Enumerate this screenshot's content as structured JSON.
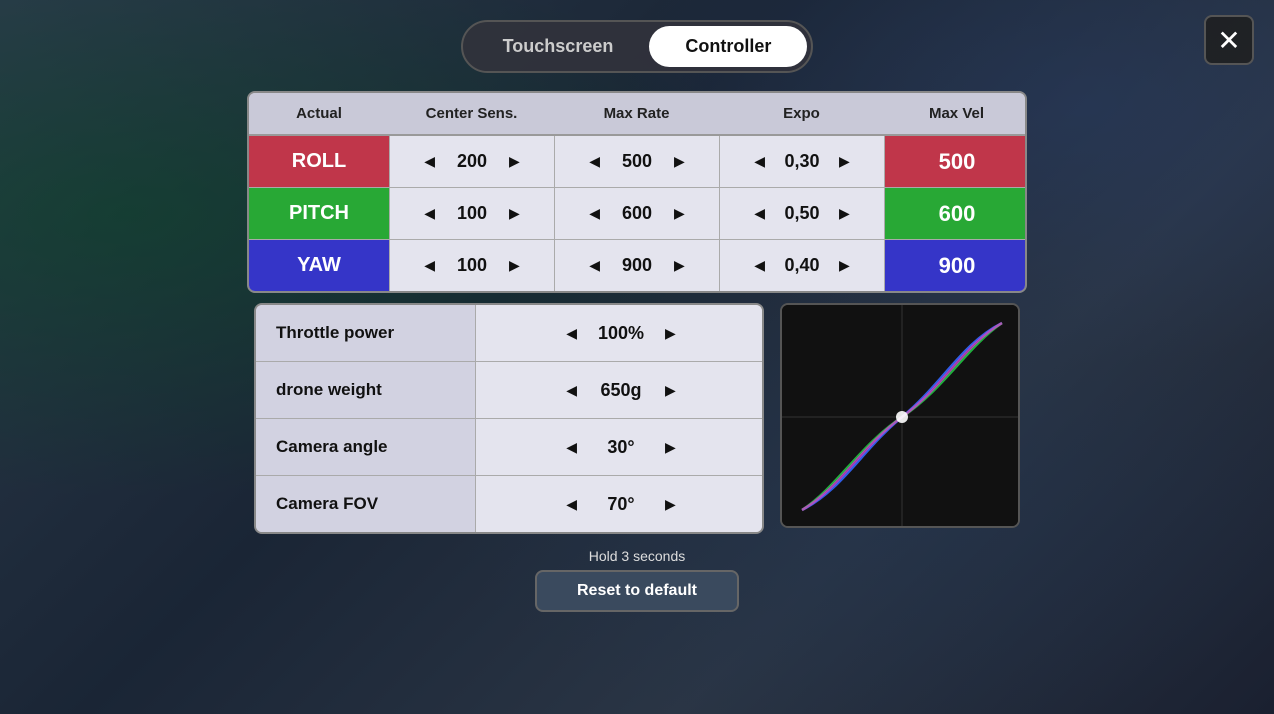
{
  "tabs": {
    "touchscreen": "Touchscreen",
    "controller": "Controller",
    "active": "controller"
  },
  "close_btn": "✕",
  "table": {
    "headers": {
      "actual": "Actual",
      "center_sens": "Center Sens.",
      "max_rate": "Max Rate",
      "expo": "Expo",
      "max_vel": "Max Vel"
    },
    "rows": [
      {
        "label": "ROLL",
        "color_class": "roll",
        "actual": "200",
        "max_rate": "500",
        "expo": "0,30",
        "max_vel": "500"
      },
      {
        "label": "PITCH",
        "color_class": "pitch",
        "actual": "100",
        "max_rate": "600",
        "expo": "0,50",
        "max_vel": "600"
      },
      {
        "label": "YAW",
        "color_class": "yaw",
        "actual": "100",
        "max_rate": "900",
        "expo": "0,40",
        "max_vel": "900"
      }
    ]
  },
  "bottom_settings": [
    {
      "label": "Throttle power",
      "value": "100%"
    },
    {
      "label": "drone weight",
      "value": "650g"
    },
    {
      "label": "Camera angle",
      "value": "30°"
    },
    {
      "label": "Camera FOV",
      "value": "70°"
    }
  ],
  "footer": {
    "hold_text": "Hold 3 seconds",
    "reset_label": "Reset to default"
  }
}
